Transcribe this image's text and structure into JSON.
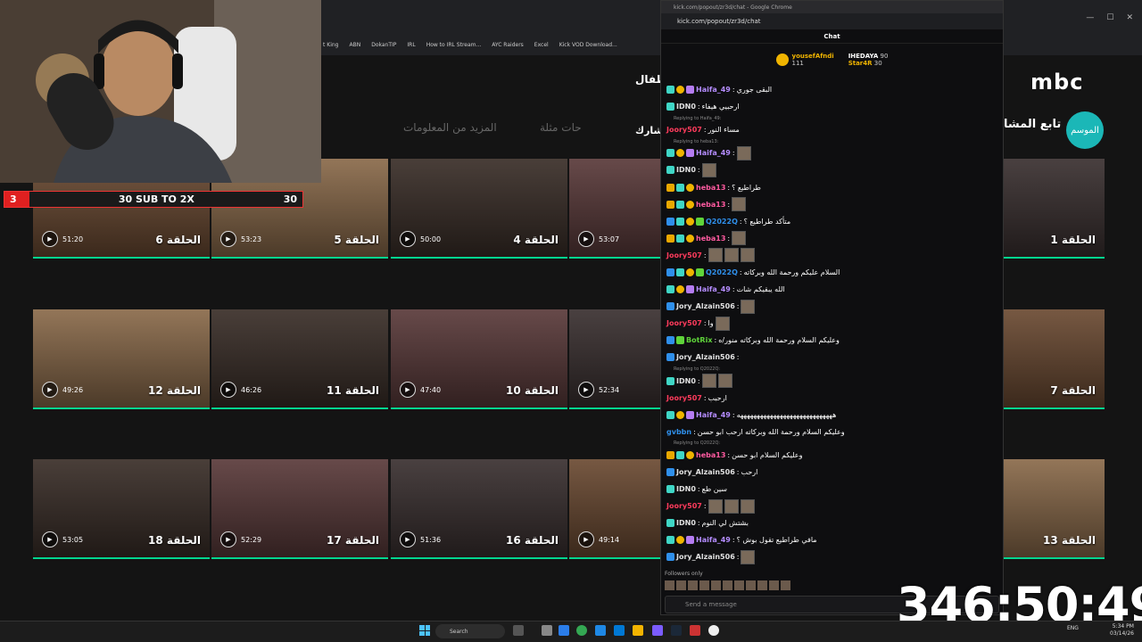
{
  "browser": {
    "bookmarks": [
      "t King",
      "ABN",
      "DokanTIP",
      "IRL",
      "How to IRL Stream...",
      "AYC Raiders",
      "Excel",
      "Kick VOD Download..."
    ]
  },
  "site": {
    "logo": "mbc",
    "nav_item": "طفال",
    "logo_badge": "الموسم",
    "header_text": "تابع المشا",
    "tabs": [
      "المزيد من المعلومات",
      "حات مثلة",
      "شارك"
    ]
  },
  "episodes": [
    {
      "title": "الحلقة 6",
      "duration": "51:20"
    },
    {
      "title": "الحلقة 5",
      "duration": "53:23"
    },
    {
      "title": "الحلقة 4",
      "duration": "50:00"
    },
    {
      "title": "",
      "duration": "53:07"
    },
    {
      "title": "الحلقة 1",
      "duration": ""
    },
    {
      "title": "الحلقة 12",
      "duration": "49:26"
    },
    {
      "title": "الحلقة 11",
      "duration": "46:26"
    },
    {
      "title": "الحلقة 10",
      "duration": "47:40"
    },
    {
      "title": "",
      "duration": "52:34"
    },
    {
      "title": "الحلقة 7",
      "duration": ""
    },
    {
      "title": "الحلقة 18",
      "duration": "53:05"
    },
    {
      "title": "الحلقة 17",
      "duration": "52:29"
    },
    {
      "title": "الحلقة 16",
      "duration": "51:36"
    },
    {
      "title": "",
      "duration": "49:14"
    },
    {
      "title": "الحلقة 13",
      "duration": ""
    }
  ],
  "overlay": {
    "sub_count": "3",
    "sub_label": "30 SUB TO 2X",
    "sub_goal": "30",
    "timer": "346:50:49"
  },
  "chat": {
    "window_title": "kick.com/popout/zr3d/chat - Google Chrome",
    "url": "kick.com/popout/zr3d/chat",
    "header": "Chat",
    "leaders": [
      {
        "name": "yousefAfndi",
        "count": "111"
      },
      {
        "name": "IHEDAYA",
        "count": "90"
      },
      {
        "name": "Star4R",
        "count": "30"
      }
    ],
    "messages": [
      {
        "user": "Haifa_49",
        "color": "#b48cff",
        "text": "البقى جوري",
        "badges": [
          "sub",
          "lvl",
          "gift"
        ],
        "emotes": 0,
        "reply": ""
      },
      {
        "user": "IDN0",
        "color": "#e0e0e0",
        "text": "ارحبيي هيفاء",
        "badges": [
          "sub"
        ],
        "emotes": 0,
        "reply": ""
      },
      {
        "user": "Joory507",
        "color": "#ff3b5c",
        "text": "مساء النور",
        "badges": [],
        "emotes": 0,
        "reply": "Replying to Haifa_49:"
      },
      {
        "user": "Haifa_49",
        "color": "#b48cff",
        "text": "",
        "badges": [
          "sub",
          "lvl",
          "gift"
        ],
        "emotes": 1,
        "reply": "Replying to heba13:"
      },
      {
        "user": "IDN0",
        "color": "#e0e0e0",
        "text": "",
        "badges": [
          "sub"
        ],
        "emotes": 1,
        "reply": ""
      },
      {
        "user": "heba13",
        "color": "#ff5aa0",
        "text": "طراطيع ؟",
        "badges": [
          "vip",
          "sub",
          "lvl"
        ],
        "emotes": 0,
        "reply": ""
      },
      {
        "user": "heba13",
        "color": "#ff5aa0",
        "text": "",
        "badges": [
          "vip",
          "sub",
          "lvl"
        ],
        "emotes": 1,
        "reply": ""
      },
      {
        "user": "Q2022Q",
        "color": "#2f8fea",
        "text": "متأكد طراطيع ؟",
        "badges": [
          "mod",
          "sub",
          "lvl",
          "grn"
        ],
        "emotes": 0,
        "reply": ""
      },
      {
        "user": "heba13",
        "color": "#ff5aa0",
        "text": "",
        "badges": [
          "vip",
          "sub",
          "lvl"
        ],
        "emotes": 1,
        "reply": ""
      },
      {
        "user": "Joory507",
        "color": "#ff3b5c",
        "text": "",
        "badges": [],
        "emotes": 3,
        "reply": ""
      },
      {
        "user": "Q2022Q",
        "color": "#2f8fea",
        "text": "السلام عليكم ورحمة الله وبركاته",
        "badges": [
          "mod",
          "sub",
          "lvl",
          "grn"
        ],
        "emotes": 0,
        "reply": ""
      },
      {
        "user": "Haifa_49",
        "color": "#b48cff",
        "text": "الله يبقيكم شات",
        "badges": [
          "sub",
          "lvl",
          "gift"
        ],
        "emotes": 0,
        "reply": ""
      },
      {
        "user": "Jory_Alzain506",
        "color": "#e0e0e0",
        "text": "",
        "badges": [
          "mod"
        ],
        "emotes": 1,
        "reply": ""
      },
      {
        "user": "Joory507",
        "color": "#ff3b5c",
        "text": "وا",
        "badges": [],
        "emotes": 1,
        "reply": ""
      },
      {
        "user": "BotRix",
        "color": "#5fd43a",
        "text": "وعليكم السلام ورحمة الله وبركاته منور/ه",
        "badges": [
          "mod",
          "grn"
        ],
        "emotes": 0,
        "reply": ""
      },
      {
        "user": "Jory_Alzain506",
        "color": "#e0e0e0",
        "text": "",
        "badges": [
          "mod"
        ],
        "emotes": 0,
        "reply": ""
      },
      {
        "user": "IDN0",
        "color": "#e0e0e0",
        "text": "",
        "badges": [
          "sub"
        ],
        "emotes": 2,
        "reply": "Replying to Q2022Q:"
      },
      {
        "user": "Joory507",
        "color": "#ff3b5c",
        "text": "ارحبب",
        "badges": [],
        "emotes": 0,
        "reply": ""
      },
      {
        "user": "Haifa_49",
        "color": "#b48cff",
        "text": "هههههههههههههههههههههههههههههه",
        "badges": [
          "sub",
          "lvl",
          "gift"
        ],
        "emotes": 0,
        "reply": ""
      },
      {
        "user": "gvbbn",
        "color": "#2f8fea",
        "text": "وعليكم السلام ورحمة الله وبركاته ارحب ابو حسن",
        "badges": [],
        "emotes": 0,
        "reply": ""
      },
      {
        "user": "heba13",
        "color": "#ff5aa0",
        "text": "وعليكم السلام ابو حسن",
        "badges": [
          "vip",
          "sub",
          "lvl"
        ],
        "emotes": 0,
        "reply": "Replying to Q2022Q:"
      },
      {
        "user": "Jory_Alzain506",
        "color": "#e0e0e0",
        "text": "ارحب",
        "badges": [
          "mod"
        ],
        "emotes": 0,
        "reply": ""
      },
      {
        "user": "IDN0",
        "color": "#e0e0e0",
        "text": "سين طع",
        "badges": [
          "sub"
        ],
        "emotes": 0,
        "reply": ""
      },
      {
        "user": "Joory507",
        "color": "#ff3b5c",
        "text": "",
        "badges": [],
        "emotes": 3,
        "reply": ""
      },
      {
        "user": "IDN0",
        "color": "#e0e0e0",
        "text": "بشتش لي النوم",
        "badges": [
          "sub"
        ],
        "emotes": 0,
        "reply": ""
      },
      {
        "user": "Haifa_49",
        "color": "#b48cff",
        "text": "مافي طراطيع تقول بوش ؟",
        "badges": [
          "sub",
          "lvl",
          "gift"
        ],
        "emotes": 0,
        "reply": ""
      },
      {
        "user": "Jory_Alzain506",
        "color": "#e0e0e0",
        "text": "",
        "badges": [
          "mod"
        ],
        "emotes": 1,
        "reply": ""
      }
    ],
    "followers_only": "Followers only",
    "send_placeholder": "Send a message"
  },
  "taskbar": {
    "search": "Search",
    "lang": "ENG",
    "time": "5:34 PM",
    "date": "03/14/26"
  }
}
